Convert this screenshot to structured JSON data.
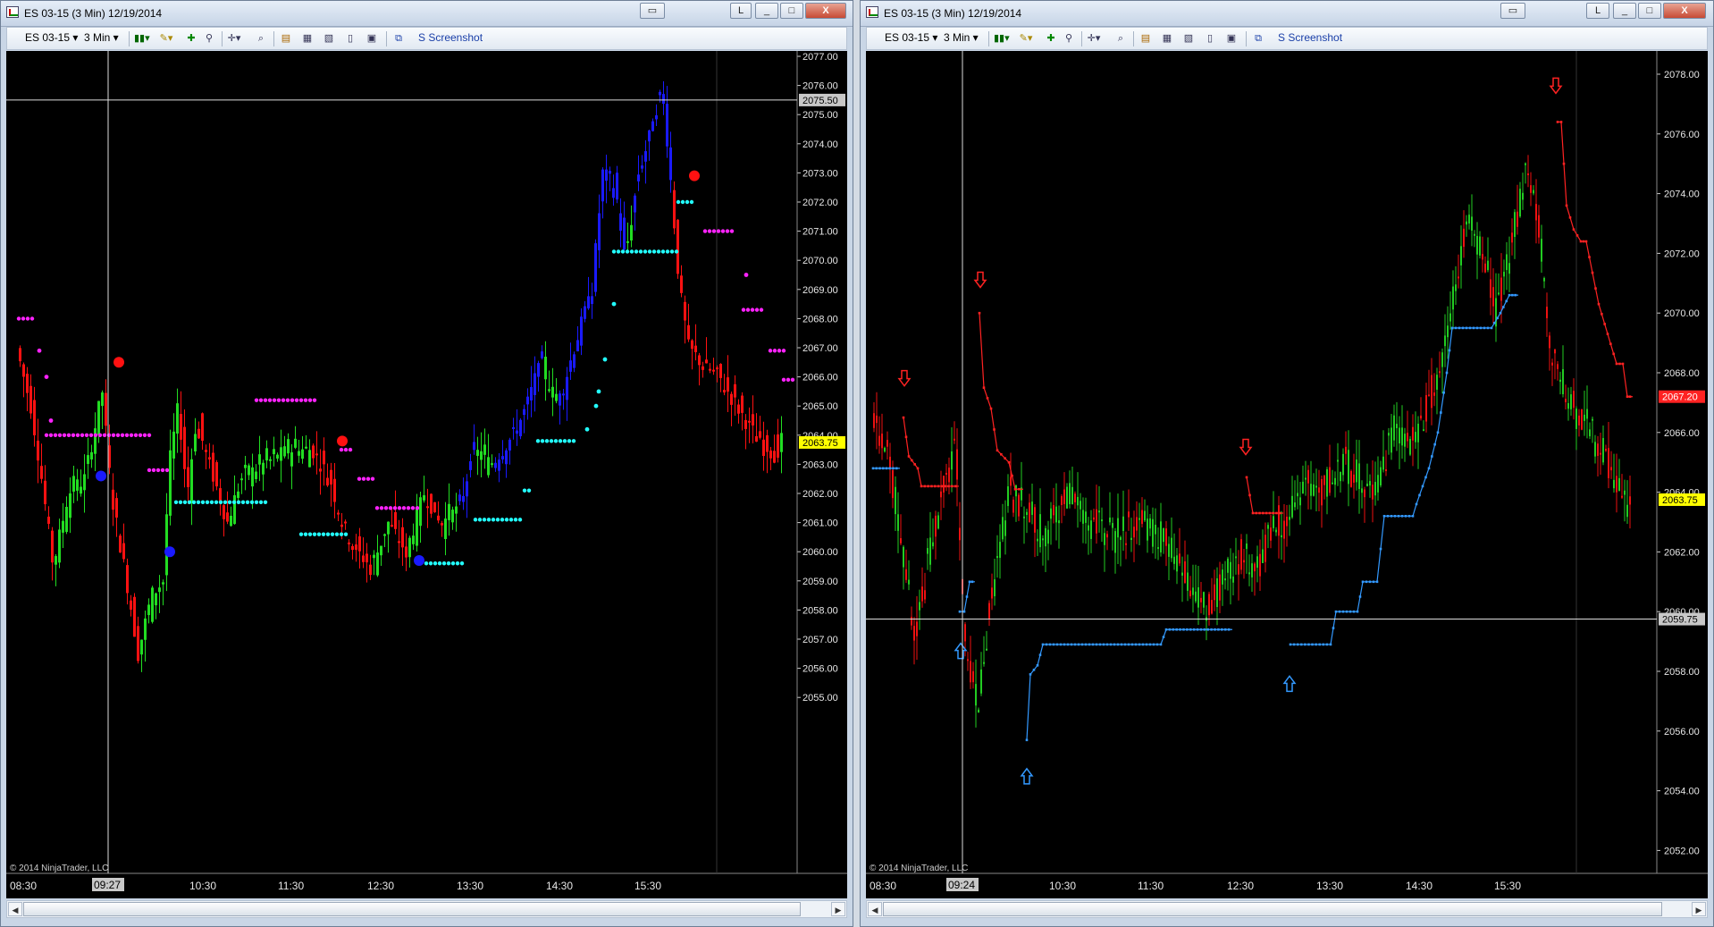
{
  "left": {
    "title": "ES 03-15 (3 Min)  12/19/2014",
    "toolbar": {
      "instrument": "ES 03-15",
      "period": "3 Min",
      "screenshot": "S Screenshot"
    },
    "price_axis": [
      "2077.00",
      "2076.00",
      "2075.00",
      "2074.00",
      "2073.00",
      "2072.00",
      "2071.00",
      "2070.00",
      "2069.00",
      "2068.00",
      "2067.00",
      "2066.00",
      "2065.00",
      "2064.00",
      "2063.00",
      "2062.00",
      "2061.00",
      "2060.00",
      "2059.00",
      "2058.00",
      "2057.00",
      "2056.00",
      "2055.00"
    ],
    "time_axis": [
      "08:30",
      "10:30",
      "11:30",
      "12:30",
      "13:30",
      "14:30",
      "15:30"
    ],
    "crosshair_time": "09:27",
    "crosshair_price": "2075.50",
    "last_price": "2063.75",
    "copyright": "© 2014 NinjaTrader, LLC",
    "colors": {
      "up": "#22dd22",
      "down": "#ff1111",
      "up_trend": "#1a1aff",
      "resistance": "#ff22ff",
      "support": "#22ffff",
      "signal_buy": "#1a1aff",
      "signal_sell": "#ff1111",
      "last_price_bg": "#ffff00"
    }
  },
  "right": {
    "title": "ES 03-15 (3 Min)  12/19/2014",
    "toolbar": {
      "instrument": "ES 03-15",
      "period": "3 Min",
      "screenshot": "S Screenshot"
    },
    "price_axis": [
      "2078.00",
      "2076.00",
      "2074.00",
      "2072.00",
      "2070.00",
      "2068.00",
      "2066.00",
      "2064.00",
      "2062.00",
      "2060.00",
      "2058.00",
      "2056.00",
      "2054.00",
      "2052.00"
    ],
    "time_axis": [
      "08:30",
      "10:30",
      "11:30",
      "12:30",
      "13:30",
      "14:30",
      "15:30"
    ],
    "crosshair_time": "09:24",
    "crosshair_price": "2059.75",
    "stop_price": "2067.20",
    "last_price": "2063.75",
    "copyright": "© 2014 NinjaTrader, LLC",
    "colors": {
      "up": "#22cc22",
      "down": "#ee1111",
      "trail_short": "#ff2222",
      "trail_long": "#3399ff",
      "last_price_bg": "#ffff00",
      "stop_bg": "#ff2222"
    }
  },
  "window_buttons": {
    "restore": "L",
    "minimize": "_",
    "maximize": "□",
    "close": "X"
  },
  "icons": {
    "app": "chart-window-icon",
    "bar_type": "candlestick-icon",
    "draw": "pencil-icon",
    "indicator": "indicator-icon",
    "crosshair": "crosshair-icon",
    "zoom": "zoom-icon",
    "properties": "properties-icon"
  }
}
